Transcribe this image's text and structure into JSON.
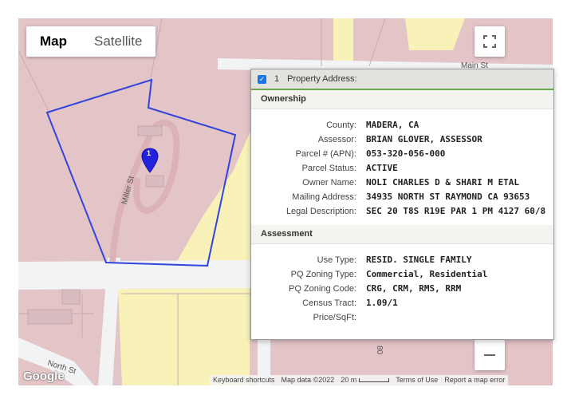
{
  "map": {
    "type_buttons": {
      "map": "Map",
      "satellite": "Satellite"
    },
    "road_labels": {
      "main_st": "Main St",
      "miller_st": "Miller St",
      "north_st": "North St",
      "side_road": "80"
    },
    "marker_label": "1",
    "logo": "Google",
    "attribution": {
      "keyboard": "Keyboard shortcuts",
      "map_data": "Map data ©2022",
      "scale": "20 m",
      "terms": "Terms of Use",
      "report": "Report a map error"
    },
    "colors": {
      "parcel": "#e3c5c8",
      "commercial": "#f8f2b9",
      "road": "#f1f3f4",
      "boundary": "#3344dd",
      "marker": "#2222dd"
    }
  },
  "popup": {
    "checked": true,
    "number": "1",
    "title": "Property Address:",
    "sections": {
      "ownership": {
        "title": "Ownership",
        "rows": [
          {
            "label": "County:",
            "value": "MADERA, CA"
          },
          {
            "label": "Assessor:",
            "value": "BRIAN GLOVER, ASSESSOR"
          },
          {
            "label": "Parcel # (APN):",
            "value": "053-320-056-000"
          },
          {
            "label": "Parcel Status:",
            "value": "ACTIVE"
          },
          {
            "label": "Owner Name:",
            "value": "NOLI CHARLES D & SHARI M ETAL"
          },
          {
            "label": "Mailing Address:",
            "value": "34935 NORTH ST RAYMOND CA 93653"
          },
          {
            "label": "Legal Description:",
            "value": "SEC 20 T8S R19E PAR 1 PM 4127 60/8"
          }
        ]
      },
      "assessment": {
        "title": "Assessment",
        "rows": [
          {
            "label": "Use Type:",
            "value": "RESID. SINGLE FAMILY"
          },
          {
            "label": "PQ Zoning Type:",
            "value": "Commercial, Residential"
          },
          {
            "label": "PQ Zoning Code:",
            "value": "CRG, CRM, RMS, RRM"
          },
          {
            "label": "Census Tract:",
            "value": "1.09/1"
          },
          {
            "label": "Price/SqFt:",
            "value": ""
          }
        ]
      }
    }
  }
}
